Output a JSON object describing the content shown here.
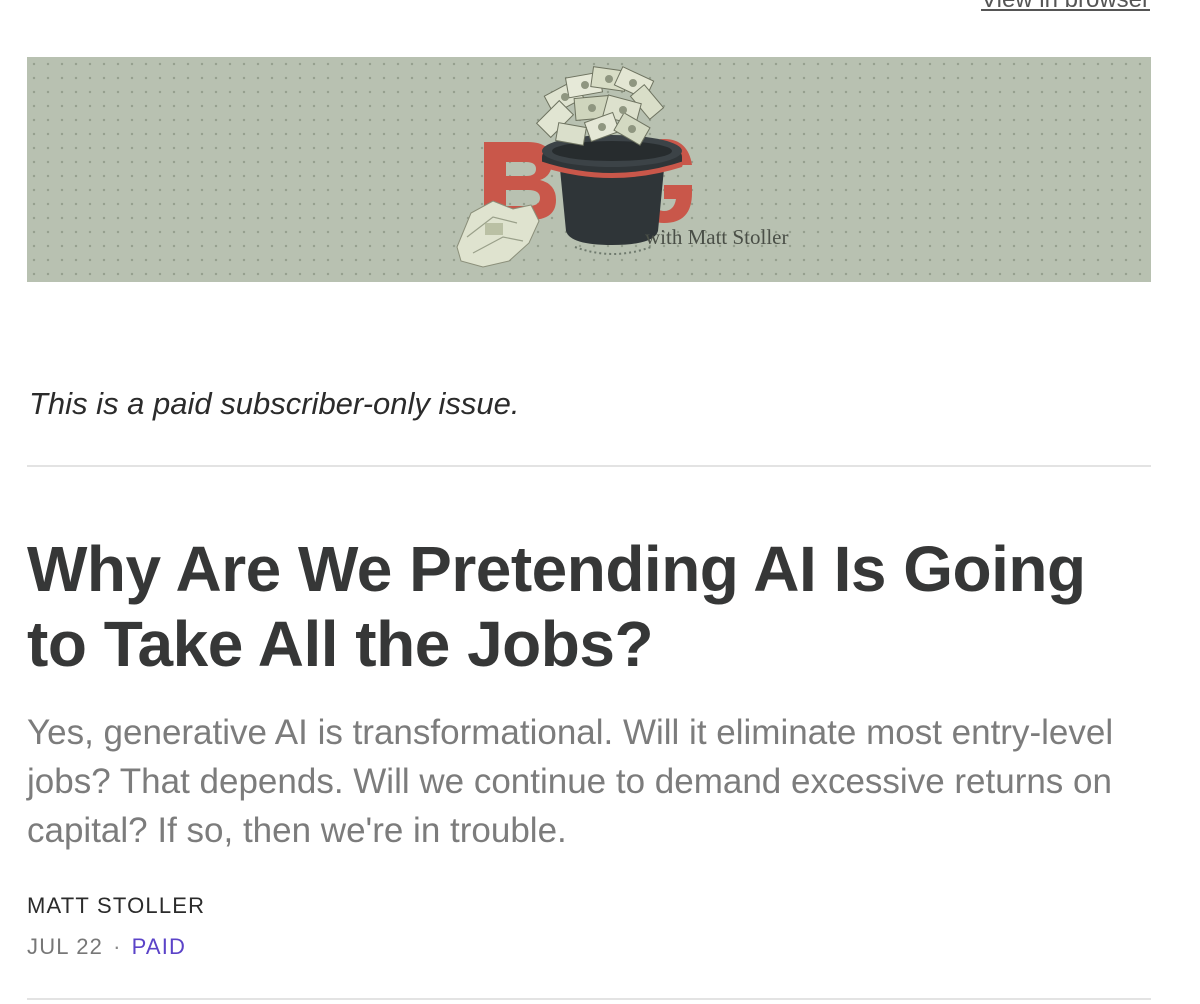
{
  "header": {
    "view_in_browser": "View in browser"
  },
  "banner": {
    "logo_letters": "BIG",
    "tagline": "with Matt Stoller",
    "background": "#b8c1b1",
    "accent": "#c9574a",
    "icon": "top-hat-with-money-icon"
  },
  "notice": "This is a paid subscriber-only issue.",
  "article": {
    "title": "Why Are We Pretending AI Is Going to Take All the Jobs?",
    "subtitle": "Yes, generative AI is transformational. Will it eliminate most entry-level jobs? That depends. Will we continue to demand excessive returns on capital? If so, then we're in trouble.",
    "author": "MATT STOLLER",
    "date": "JUL 22",
    "separator": "·",
    "access": "PAID",
    "access_color": "#5b43c8"
  }
}
